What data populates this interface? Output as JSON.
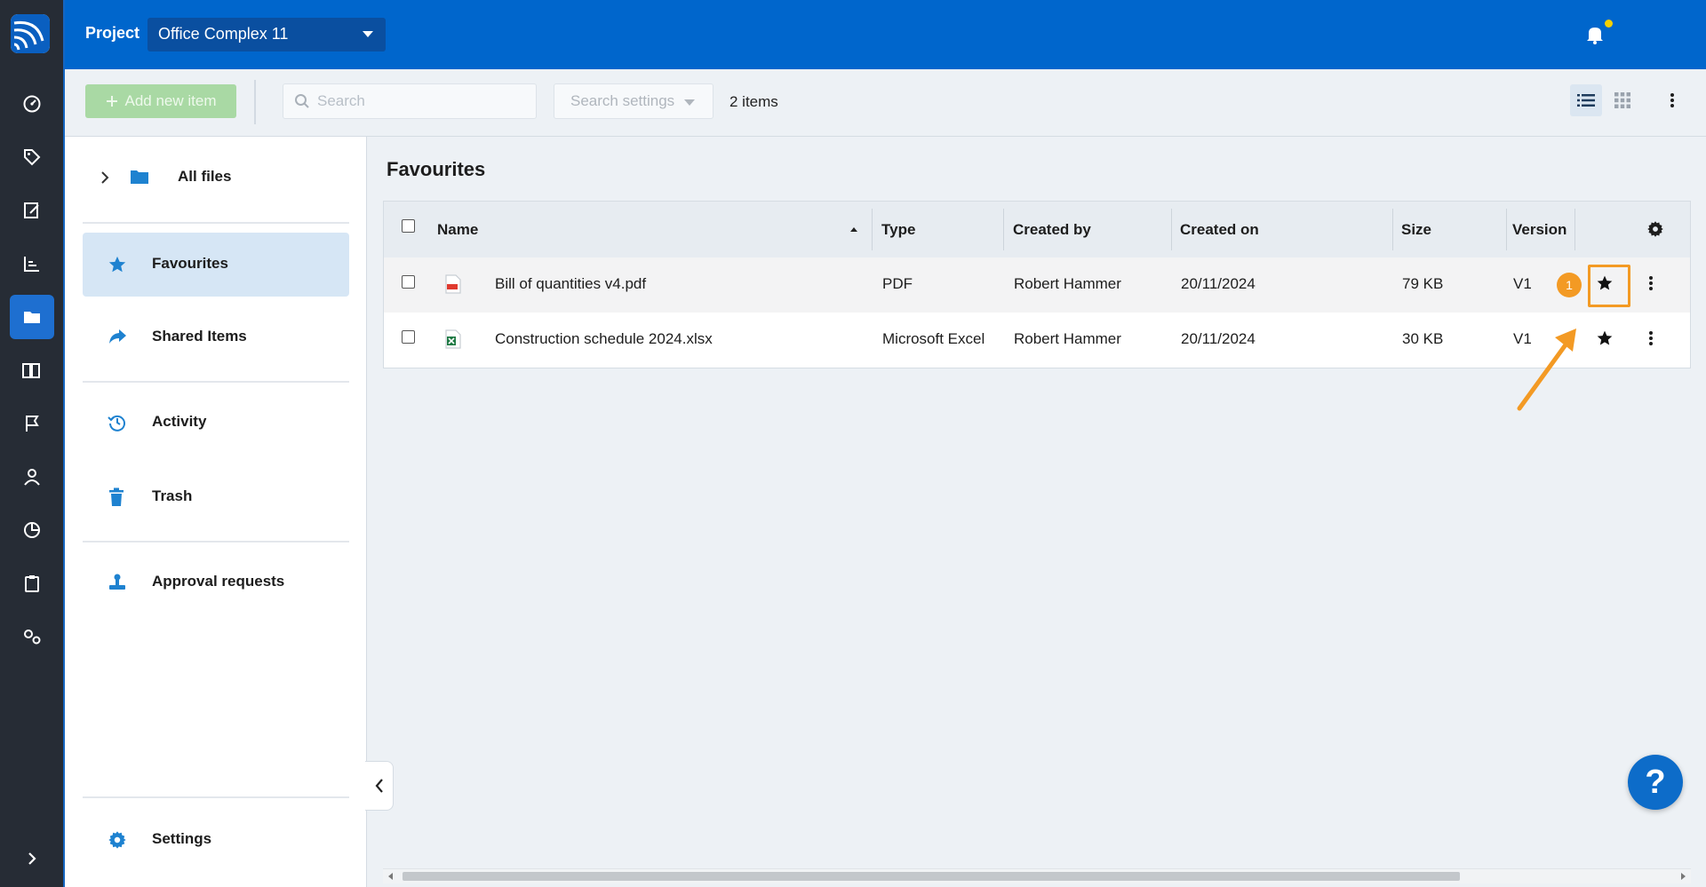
{
  "topbar": {
    "project_label": "Project",
    "project_value": "Office Complex 11"
  },
  "toolbar": {
    "add_label": "Add new item",
    "search_placeholder": "Search",
    "search_settings_label": "Search settings",
    "item_count": "2 items"
  },
  "sidebar": {
    "all_files": "All files",
    "favourites": "Favourites",
    "shared": "Shared Items",
    "activity": "Activity",
    "trash": "Trash",
    "approvals": "Approval requests",
    "settings": "Settings"
  },
  "main": {
    "title": "Favourites",
    "columns": {
      "name": "Name",
      "type": "Type",
      "created_by": "Created by",
      "created_on": "Created on",
      "size": "Size",
      "version": "Version"
    },
    "rows": [
      {
        "name": "Bill of quantities v4.pdf",
        "type": "PDF",
        "created_by": "Robert Hammer",
        "created_on": "20/11/2024",
        "size": "79 KB",
        "version": "V1",
        "icon": "pdf-file-icon"
      },
      {
        "name": "Construction schedule 2024.xlsx",
        "type": "Microsoft Excel",
        "created_by": "Robert Hammer",
        "created_on": "20/11/2024",
        "size": "30 KB",
        "version": "V1",
        "icon": "excel-file-icon"
      }
    ]
  },
  "annotation": {
    "step": "1"
  },
  "help": {
    "label": "?"
  },
  "colors": {
    "topbar": "#0066cc",
    "rail": "#262c35",
    "accent": "#1e6fd0",
    "highlight": "#f39a24",
    "add_button": "#a9d9a4"
  }
}
